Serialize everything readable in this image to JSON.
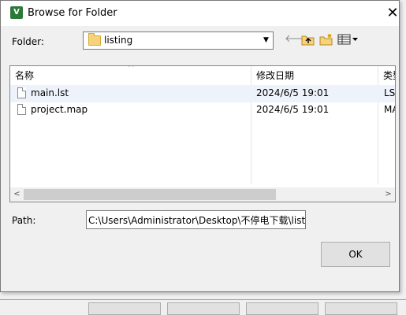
{
  "dialog": {
    "title": "Browse for Folder",
    "app_icon_label": "V",
    "close_label": "✕",
    "folder_label": "Folder:",
    "folder_value": "listing",
    "path_label": "Path:",
    "path_value": "C:\\Users\\Administrator\\Desktop\\不停电下载\\list",
    "ok_label": "OK"
  },
  "toolbar": {
    "back_icon": "back-arrow-icon",
    "up_icon": "up-folder-icon",
    "new_folder_icon": "new-folder-icon",
    "view_menu_icon": "view-menu-icon"
  },
  "list": {
    "columns": [
      "名称",
      "修改日期",
      "类型"
    ],
    "rows": [
      {
        "name": "main.lst",
        "modified": "2024/6/5 19:01",
        "type": "LST"
      },
      {
        "name": "project.map",
        "modified": "2024/6/5 19:01",
        "type": "MAP"
      }
    ]
  }
}
